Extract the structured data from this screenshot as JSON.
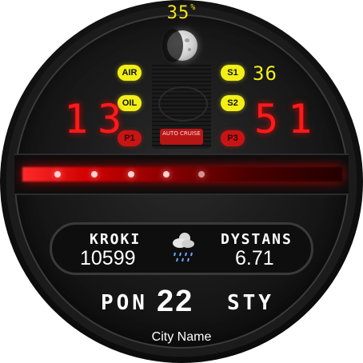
{
  "battery": {
    "value": "35",
    "unit": "%"
  },
  "moon": {
    "phase_icon": "moon-waxing-gibbous-icon"
  },
  "indicators": {
    "air": "AIR",
    "oil": "OIL",
    "p1": "P1",
    "s1": "S1",
    "s2": "S2",
    "p3": "P3",
    "auto_cruise": "AUTO CRUISE"
  },
  "side_value": "36",
  "time": {
    "hours": "13",
    "minutes": "51"
  },
  "stats": {
    "left_label": "KROKI",
    "left_value": "10599",
    "right_label": "DYSTANS",
    "right_value": "6.71",
    "weather_icon": "cloud-rain-icon"
  },
  "date": {
    "weekday": "PON",
    "day": "22",
    "month": "STY"
  },
  "city": "City Name",
  "colors": {
    "accent_red": "#ff1a1a",
    "accent_yellow": "#f1ef17"
  }
}
